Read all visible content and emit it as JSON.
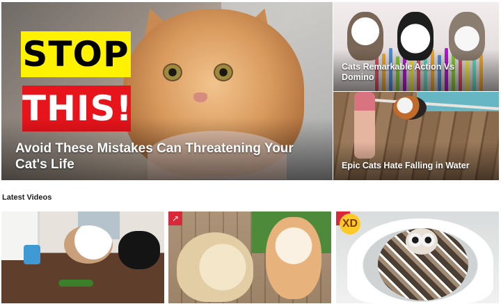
{
  "featured": {
    "main": {
      "title": "Avoid These Mistakes Can Threatening Your Cat's Life",
      "overlay_line1": "STOP",
      "overlay_line2": "THIS!"
    },
    "side": [
      {
        "title": "Cats Remarkable Action Vs Domino"
      },
      {
        "title": "Epic Cats Hate Falling in Water"
      }
    ]
  },
  "latest": {
    "heading": "Latest Videos",
    "items": [
      {
        "badge_icon": "trending-icon",
        "badge": ""
      },
      {
        "badge_icon": "trending-icon",
        "badge": "↗"
      },
      {
        "badge_icon": "trending-icon",
        "badge": "↗",
        "emoji_icon": "laughing-emoji-icon",
        "emoji": "XD"
      }
    ]
  },
  "colors": {
    "stop_bg": "#fff200",
    "this_bg": "#e8141b",
    "badge_bg": "#d8283a"
  }
}
